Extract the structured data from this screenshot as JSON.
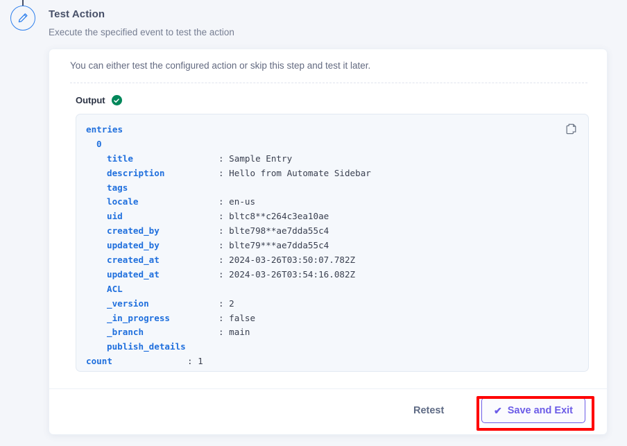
{
  "step": {
    "icon": "pencil-edit-icon",
    "accent_color": "#2f80ed"
  },
  "header": {
    "title": "Test Action",
    "subtitle": "Execute the specified event to test the action"
  },
  "card": {
    "intro": "You can either test the configured action or skip this step and test it later.",
    "output": {
      "label": "Output",
      "status_icon": "green-check-badge-icon",
      "status_color": "#00875a"
    },
    "copy_icon": "copy-icon"
  },
  "tree": [
    {
      "indent": 0,
      "key": "entries",
      "colon": "",
      "value": ""
    },
    {
      "indent": 1,
      "key": "0",
      "colon": "",
      "value": ""
    },
    {
      "indent": 2,
      "key": "title",
      "colon": ":",
      "value": "Sample Entry"
    },
    {
      "indent": 2,
      "key": "description",
      "colon": ":",
      "value": "Hello from Automate Sidebar"
    },
    {
      "indent": 2,
      "key": "tags",
      "colon": "",
      "value": ""
    },
    {
      "indent": 2,
      "key": "locale",
      "colon": ":",
      "value": "en-us"
    },
    {
      "indent": 2,
      "key": "uid",
      "colon": ":",
      "value": "bltc8**c264c3ea10ae"
    },
    {
      "indent": 2,
      "key": "created_by",
      "colon": ":",
      "value": "blte798**ae7dda55c4"
    },
    {
      "indent": 2,
      "key": "updated_by",
      "colon": ":",
      "value": "blte79***ae7dda55c4"
    },
    {
      "indent": 2,
      "key": "created_at",
      "colon": ":",
      "value": "2024-03-26T03:50:07.782Z"
    },
    {
      "indent": 2,
      "key": "updated_at",
      "colon": ":",
      "value": "2024-03-26T03:54:16.082Z"
    },
    {
      "indent": 2,
      "key": "ACL",
      "colon": "",
      "value": ""
    },
    {
      "indent": 2,
      "key": "_version",
      "colon": ":",
      "value": "2"
    },
    {
      "indent": 2,
      "key": "_in_progress",
      "colon": ":",
      "value": "false"
    },
    {
      "indent": 2,
      "key": "_branch",
      "colon": ":",
      "value": "main"
    },
    {
      "indent": 2,
      "key": "publish_details",
      "colon": "",
      "value": ""
    },
    {
      "indent": 0,
      "key": "count",
      "colon": ":",
      "value": "1"
    }
  ],
  "footer": {
    "retest_label": "Retest",
    "save_label": "Save and Exit",
    "save_check_glyph": "✔",
    "save_accent": "#6c5ce7"
  },
  "annotation": {
    "color": "#ff0000",
    "target": "save-and-exit-button"
  }
}
